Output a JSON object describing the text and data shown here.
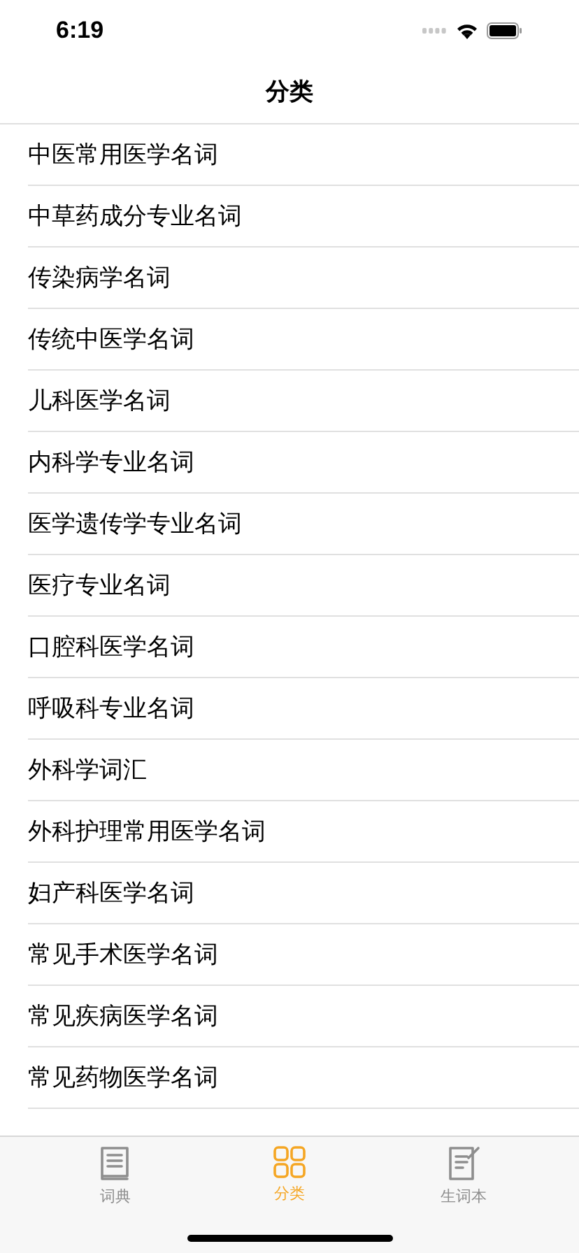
{
  "status_bar": {
    "time": "6:19"
  },
  "header": {
    "title": "分类"
  },
  "categories": [
    {
      "label": "中医常用医学名词"
    },
    {
      "label": "中草药成分专业名词"
    },
    {
      "label": "传染病学名词"
    },
    {
      "label": "传统中医学名词"
    },
    {
      "label": "儿科医学名词"
    },
    {
      "label": "内科学专业名词"
    },
    {
      "label": "医学遗传学专业名词"
    },
    {
      "label": "医疗专业名词"
    },
    {
      "label": "口腔科医学名词"
    },
    {
      "label": "呼吸科专业名词"
    },
    {
      "label": "外科学词汇"
    },
    {
      "label": "外科护理常用医学名词"
    },
    {
      "label": "妇产科医学名词"
    },
    {
      "label": "常见手术医学名词"
    },
    {
      "label": "常见疾病医学名词"
    },
    {
      "label": "常见药物医学名词"
    }
  ],
  "tab_bar": [
    {
      "kind": "book",
      "label": "词典",
      "selected": false
    },
    {
      "kind": "grid",
      "label": "分类",
      "selected": true
    },
    {
      "kind": "note",
      "label": "生词本",
      "selected": false
    }
  ]
}
